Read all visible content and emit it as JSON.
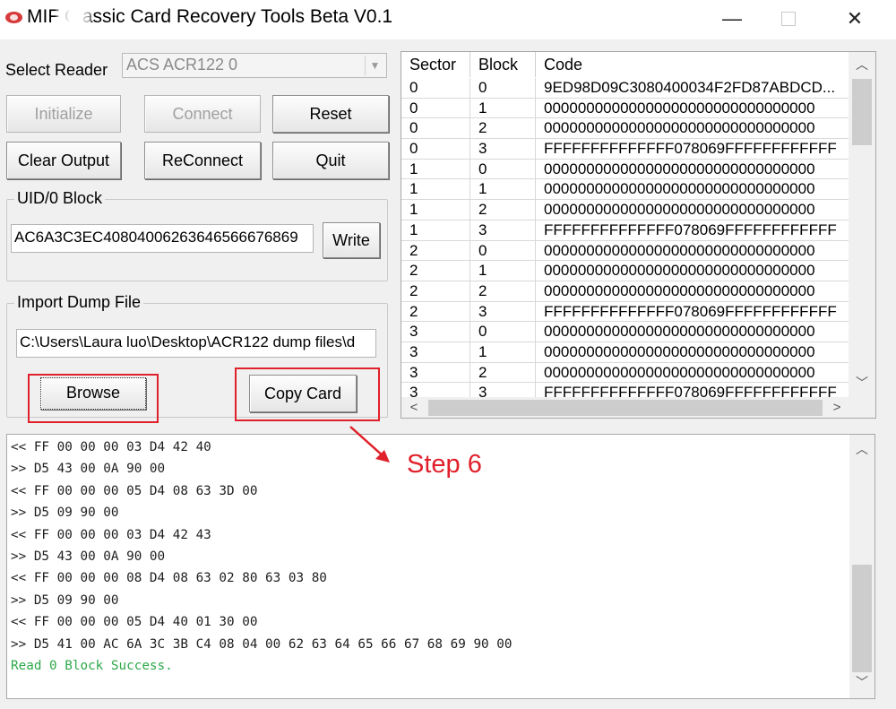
{
  "window": {
    "title": "MIF    Classic Card Recovery Tools Beta V0.1",
    "minimize": "—",
    "close": "✕"
  },
  "reader": {
    "label": "Select Reader",
    "selected": "ACS ACR122 0"
  },
  "buttons": {
    "initialize": "Initialize",
    "connect": "Connect",
    "reset": "Reset",
    "clear_output": "Clear Output",
    "reconnect": "ReConnect",
    "quit": "Quit",
    "write": "Write",
    "browse": "Browse",
    "copy_card": "Copy Card"
  },
  "uid_block": {
    "title": "UID/0 Block",
    "value": "AC6A3C3EC40804006263646566676869"
  },
  "import_dump": {
    "title": "Import Dump File",
    "path": "C:\\Users\\Laura luo\\Desktop\\ACR122 dump files\\d"
  },
  "grid": {
    "columns": [
      "Sector",
      "Block",
      "Code"
    ],
    "rows": [
      [
        "0",
        "0",
        "9ED98D09C3080400034F2FD87ABDCD..."
      ],
      [
        "0",
        "1",
        "00000000000000000000000000000000"
      ],
      [
        "0",
        "2",
        "00000000000000000000000000000000"
      ],
      [
        "0",
        "3",
        "FFFFFFFFFFFFFF078069FFFFFFFFFFFF"
      ],
      [
        "1",
        "0",
        "00000000000000000000000000000000"
      ],
      [
        "1",
        "1",
        "00000000000000000000000000000000"
      ],
      [
        "1",
        "2",
        "00000000000000000000000000000000"
      ],
      [
        "1",
        "3",
        "FFFFFFFFFFFFFF078069FFFFFFFFFFFF"
      ],
      [
        "2",
        "0",
        "00000000000000000000000000000000"
      ],
      [
        "2",
        "1",
        "00000000000000000000000000000000"
      ],
      [
        "2",
        "2",
        "00000000000000000000000000000000"
      ],
      [
        "2",
        "3",
        "FFFFFFFFFFFFFF078069FFFFFFFFFFFF"
      ],
      [
        "3",
        "0",
        "00000000000000000000000000000000"
      ],
      [
        "3",
        "1",
        "00000000000000000000000000000000"
      ],
      [
        "3",
        "2",
        "00000000000000000000000000000000"
      ],
      [
        "3",
        "3",
        "FFFFFFFFFFFFFF078069FFFFFFFFFFFF"
      ]
    ]
  },
  "output": {
    "lines": [
      "<< FF 00 00 00 03 D4 42 40",
      ">> D5 43 00 0A 90 00",
      "<< FF 00 00 00 05 D4 08 63 3D 00",
      ">> D5 09 90 00",
      "<< FF 00 00 00 03 D4 42 43",
      ">> D5 43 00 0A 90 00",
      "<< FF 00 00 00 08 D4 08 63 02 80 63 03 80",
      ">> D5 09 90 00",
      "<< FF 00 00 00 05 D4 40 01 30 00",
      ">> D5 41 00 AC 6A 3C 3B C4 08 04 00 62 63 64 65 66 67 68 69 90 00"
    ],
    "success": "Read 0 Block Success."
  },
  "annotation": {
    "label": "Step 6",
    "color": "#e0202a"
  },
  "icons": [
    "app-icon",
    "dropdown-arrow-icon",
    "scroll-up-icon",
    "scroll-down-icon",
    "scroll-left-icon",
    "scroll-right-icon",
    "arrow-annotation-icon"
  ]
}
